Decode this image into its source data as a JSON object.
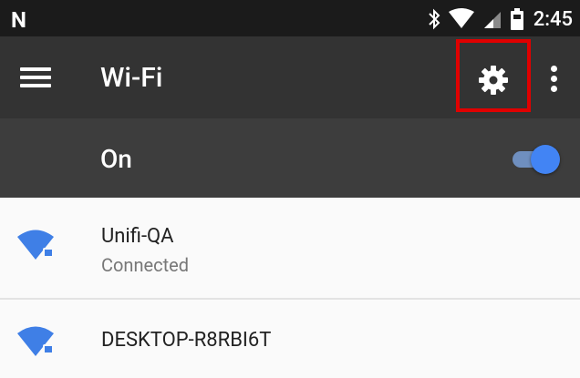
{
  "status_bar": {
    "carrier_logo": "N",
    "time": "2:45",
    "icons": [
      "bluetooth-icon",
      "wifi-signal-icon",
      "cell-signal-icon",
      "battery-icon"
    ]
  },
  "toolbar": {
    "title": "Wi-Fi",
    "menu_icon": "hamburger-menu-icon",
    "settings_icon": "gear-icon",
    "overflow_icon": "more-vert-icon"
  },
  "wifi_toggle": {
    "label": "On",
    "state": "on"
  },
  "networks": [
    {
      "name": "Unifi-QA",
      "status": "Connected",
      "icon": "wifi-lock-icon"
    },
    {
      "name": "DESKTOP-R8RBI6T",
      "status": "",
      "icon": "wifi-lock-icon"
    }
  ],
  "colors": {
    "status_bar_bg": "#1b1b1b",
    "toolbar_bg": "#333333",
    "switch_bar_bg": "#3d3d3d",
    "accent": "#4284f4",
    "highlight": "#e00000"
  }
}
